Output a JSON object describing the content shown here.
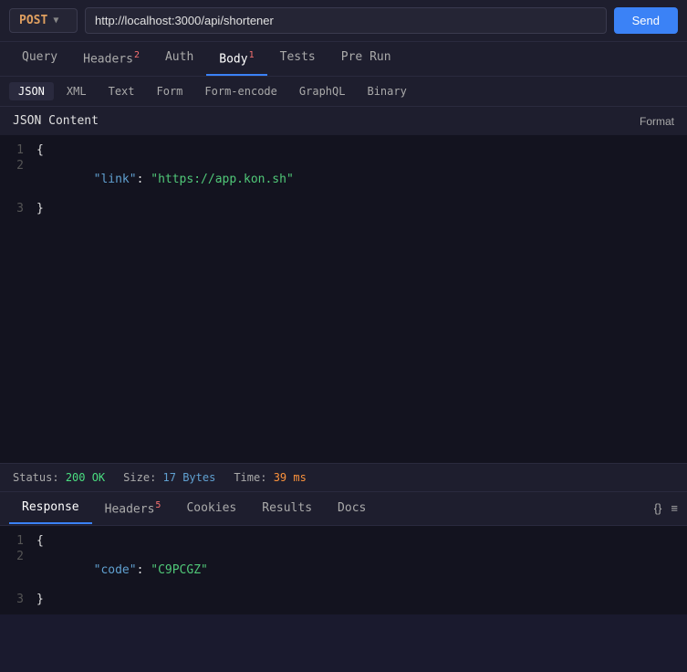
{
  "topbar": {
    "method": "POST",
    "url": "http://localhost:3000/api/shortener",
    "send_label": "Send"
  },
  "main_tabs": [
    {
      "id": "query",
      "label": "Query",
      "badge": null,
      "active": false
    },
    {
      "id": "headers",
      "label": "Headers",
      "badge": "2",
      "active": false
    },
    {
      "id": "auth",
      "label": "Auth",
      "badge": null,
      "active": false
    },
    {
      "id": "body",
      "label": "Body",
      "badge": "1",
      "active": true
    },
    {
      "id": "tests",
      "label": "Tests",
      "badge": null,
      "active": false
    },
    {
      "id": "pre_run",
      "label": "Pre Run",
      "badge": null,
      "active": false
    }
  ],
  "body_tabs": [
    {
      "id": "json",
      "label": "JSON",
      "active": true
    },
    {
      "id": "xml",
      "label": "XML",
      "active": false
    },
    {
      "id": "text",
      "label": "Text",
      "active": false
    },
    {
      "id": "form",
      "label": "Form",
      "active": false
    },
    {
      "id": "form_encode",
      "label": "Form-encode",
      "active": false
    },
    {
      "id": "graphql",
      "label": "GraphQL",
      "active": false
    },
    {
      "id": "binary",
      "label": "Binary",
      "active": false
    }
  ],
  "json_section": {
    "label": "JSON Content",
    "format_label": "Format"
  },
  "code_editor": {
    "lines": [
      {
        "num": 1,
        "content": "{",
        "type": "brace"
      },
      {
        "num": 2,
        "key": "\"link\"",
        "colon": ": ",
        "value": "\"https://app.kon.sh\"",
        "type": "kv"
      },
      {
        "num": 3,
        "content": "}",
        "type": "brace"
      }
    ]
  },
  "status_bar": {
    "status_label": "Status:",
    "status_value": "200 OK",
    "size_label": "Size:",
    "size_value": "17 Bytes",
    "time_label": "Time:",
    "time_value": "39 ms"
  },
  "response_tabs": [
    {
      "id": "response",
      "label": "Response",
      "active": true
    },
    {
      "id": "headers",
      "label": "Headers",
      "badge": "5",
      "active": false
    },
    {
      "id": "cookies",
      "label": "Cookies",
      "active": false
    },
    {
      "id": "results",
      "label": "Results",
      "active": false
    },
    {
      "id": "docs",
      "label": "Docs",
      "active": false
    }
  ],
  "response_actions": {
    "format_icon": "{}",
    "menu_icon": "≡"
  },
  "response_code": {
    "lines": [
      {
        "num": 1,
        "content": "{",
        "type": "brace"
      },
      {
        "num": 2,
        "key": "\"code\"",
        "colon": ": ",
        "value": "\"C9PCGZ\"",
        "type": "kv"
      },
      {
        "num": 3,
        "content": "}",
        "type": "brace"
      }
    ]
  }
}
